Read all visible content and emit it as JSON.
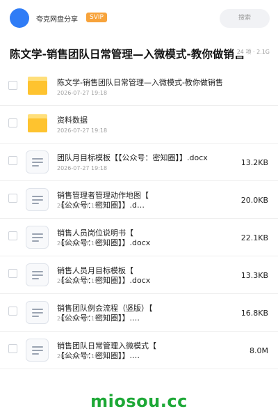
{
  "header": {
    "app_name": "夸克网盘分享",
    "badge": "SVIP",
    "search_placeholder": "搜索"
  },
  "folder": {
    "title": "陈文学-销售团队日常管理—入微模式-教你做销售",
    "meta": "24 项 · 2.1G"
  },
  "files": [
    {
      "type": "folder",
      "name": "陈文学-销售团队日常管理—入微模式-教你做销售",
      "date": "2026-07-27 19:18",
      "size": ""
    },
    {
      "type": "folder",
      "name": "资料数据",
      "date": "2026-07-27 19:18",
      "size": ""
    },
    {
      "type": "doc",
      "name": "团队月目标模板【【公众号：密知圈】】.docx",
      "date": "2026-07-27 19:18",
      "size": "13.2KB"
    },
    {
      "type": "doc",
      "name": "销售管理者管理动作地图【\n【公众号：密知圈】】.d…",
      "date": "2026-07-27 19:18",
      "size": "20.0KB"
    },
    {
      "type": "doc",
      "name": "销售人员岗位说明书【\n【公众号：密知圈】】.docx",
      "date": "2026-07-27 19:18",
      "size": "22.1KB"
    },
    {
      "type": "doc",
      "name": "销售人员月目标模板【\n【公众号：密知圈】】.docx",
      "date": "2026-07-27 19:18",
      "size": "13.3KB"
    },
    {
      "type": "doc",
      "name": "销售团队例会流程（竖版）【\n【公众号：密知圈】】.…",
      "date": "2026-07-27 19:18",
      "size": "16.8KB"
    },
    {
      "type": "doc",
      "name": "销售团队日常管理入微模式【\n【公众号：密知圈】】.…",
      "date": "2026-07-27 19:18",
      "size": "8.0M"
    }
  ],
  "watermark": "miosou.cc",
  "colors": {
    "avatar": "#2f7cf6",
    "badge": "#f7a33b",
    "folder": "#fec32f",
    "watermark": "#1da836"
  }
}
